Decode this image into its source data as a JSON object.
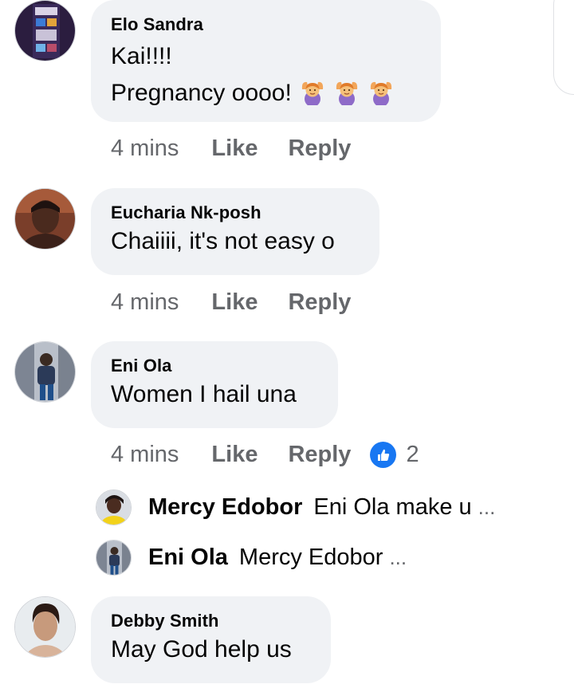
{
  "comments": [
    {
      "author": "Elo Sandra",
      "text_lines": [
        "Kai!!!!",
        "Pregnancy oooo!"
      ],
      "emoji": [
        "person-gesturing-ok-emoji",
        "person-gesturing-ok-emoji",
        "person-gesturing-ok-emoji"
      ],
      "time": "4 mins",
      "like": "Like",
      "reply": "Reply"
    },
    {
      "author": "Eucharia Nk-posh",
      "text_lines": [
        "Chaiiii, it's not easy o"
      ],
      "time": "4 mins",
      "like": "Like",
      "reply": "Reply"
    },
    {
      "author": "Eni Ola",
      "text_lines": [
        "Women I hail una"
      ],
      "time": "4 mins",
      "like": "Like",
      "reply": "Reply",
      "reaction": {
        "icon": "thumbs-up-icon",
        "count": "2",
        "color": "#1877f2"
      },
      "replies": [
        {
          "author": "Mercy Edobor",
          "text": "Eni Ola make u",
          "more": "..."
        },
        {
          "author": "Eni Ola",
          "text": "Mercy Edobor",
          "more": "..."
        }
      ]
    },
    {
      "author": "Debby Smith",
      "text_lines": [
        "May God help us"
      ]
    }
  ],
  "colors": {
    "bubble": "#f0f2f5",
    "text": "#050505",
    "meta": "#65676b",
    "accent": "#1877f2"
  }
}
